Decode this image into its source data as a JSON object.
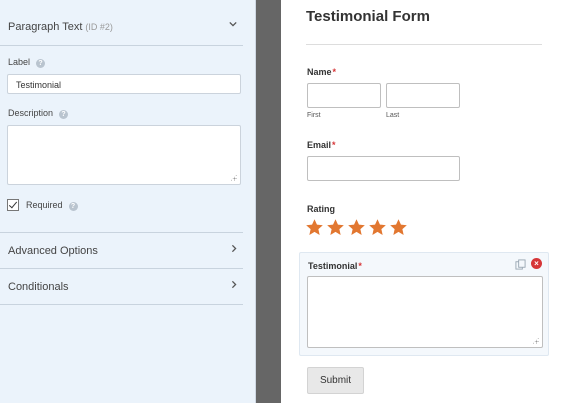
{
  "settings_panel": {
    "field_type": "Paragraph Text",
    "field_id": "(ID #2)",
    "label_caption": "Label",
    "label_value": "Testimonial",
    "description_caption": "Description",
    "description_value": "",
    "required_label": "Required",
    "required_checked": true,
    "help_glyph": "?",
    "advanced_options": "Advanced Options",
    "conditionals": "Conditionals",
    "icons": {
      "collapse": "chevron-down-icon",
      "expand": "chevron-right-icon",
      "help": "question-circle-icon"
    }
  },
  "form_preview": {
    "title": "Testimonial Form",
    "name_label": "Name",
    "required_marker": "*",
    "first_sublabel": "First",
    "last_sublabel": "Last",
    "email_label": "Email",
    "rating_label": "Rating",
    "rating_value": 5,
    "rating_max": 5,
    "testimonial_label": "Testimonial",
    "submit_label": "Submit",
    "delete_glyph": "×",
    "icons": {
      "star": "star-icon",
      "duplicate": "duplicate-icon",
      "delete": "delete-icon"
    }
  },
  "colors": {
    "panel_bg": "#ebf3fb",
    "star": "#e27730",
    "required": "#d63638",
    "gutter": "#666666"
  }
}
